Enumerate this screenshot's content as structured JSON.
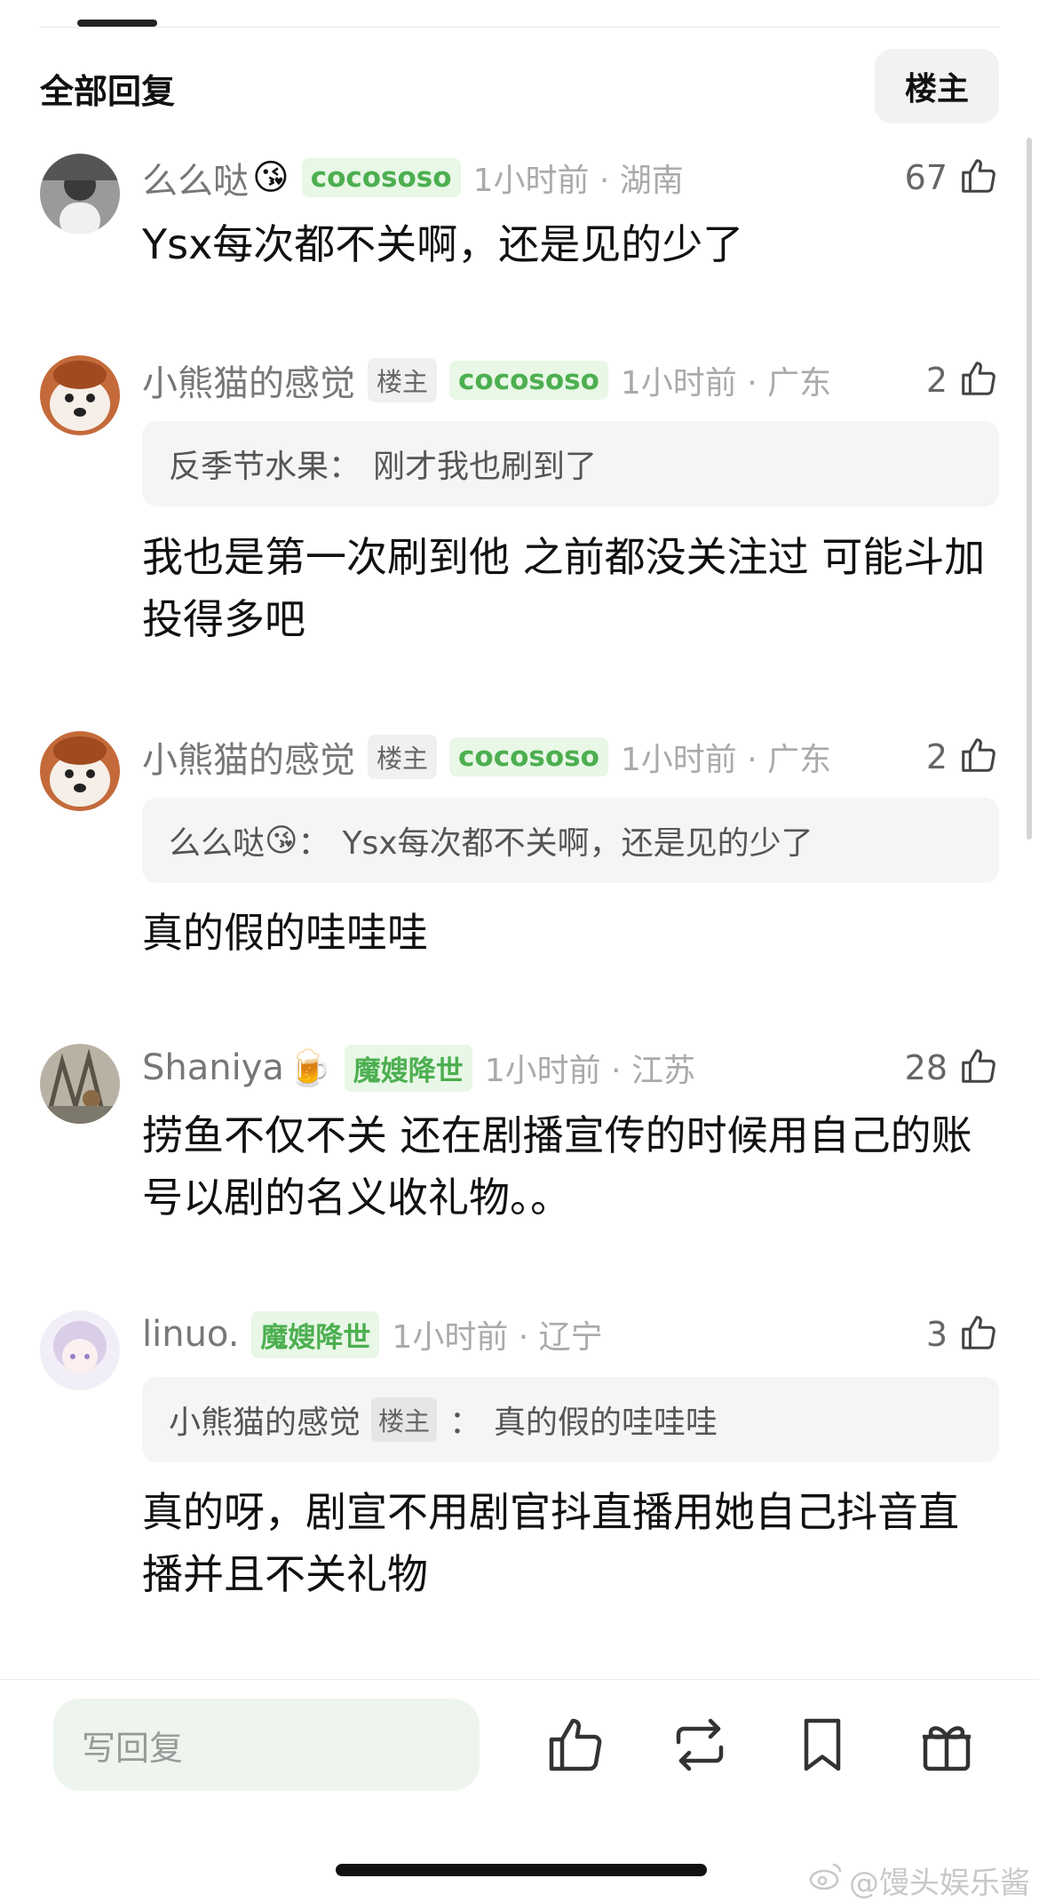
{
  "header": {
    "section_title": "全部回复",
    "op_filter_label": "楼主"
  },
  "comments": [
    {
      "username": "么么哒",
      "emoji": "😘",
      "op_badge": "",
      "fan_badge": "cocososo",
      "meta": "1小时前 · 湖南",
      "likes": "67",
      "quote": null,
      "text": "Ysx每次都不关啊，还是见的少了"
    },
    {
      "username": "小熊猫的感觉",
      "emoji": "",
      "op_badge": "楼主",
      "fan_badge": "cocososo",
      "meta": "1小时前 · 广东",
      "likes": "2",
      "quote": {
        "author": "反季节水果",
        "emoji": "",
        "badge": "",
        "text": "刚才我也刷到了"
      },
      "text": "我也是第一次刷到他 之前都没关注过 可能斗加投得多吧"
    },
    {
      "username": "小熊猫的感觉",
      "emoji": "",
      "op_badge": "楼主",
      "fan_badge": "cocososo",
      "meta": "1小时前 · 广东",
      "likes": "2",
      "quote": {
        "author": "么么哒",
        "emoji": "😘",
        "badge": "",
        "text": "Ysx每次都不关啊，还是见的少了"
      },
      "text": "真的假的哇哇哇"
    },
    {
      "username": "Shaniya",
      "emoji": "🍺",
      "op_badge": "",
      "fan_badge": "魔嫂降世",
      "meta": "1小时前 · 江苏",
      "likes": "28",
      "quote": null,
      "text": "捞鱼不仅不关 还在剧播宣传的时候用自己的账号以剧的名义收礼物。。"
    },
    {
      "username": "linuo.",
      "emoji": "",
      "op_badge": "",
      "fan_badge": "魔嫂降世",
      "meta": "1小时前 · 辽宁",
      "likes": "3",
      "quote": {
        "author": "小熊猫的感觉",
        "emoji": "",
        "badge": "楼主",
        "text": "真的假的哇哇哇"
      },
      "text": "真的呀，剧宣不用剧官抖直播用她自己抖音直播并且不关礼物"
    }
  ],
  "footer": {
    "reply_placeholder": "写回复"
  },
  "watermark": "@馒头娱乐酱",
  "colors": {
    "fan_badge_bg": "#e8f7e6",
    "fan_badge_text": "#4caf50",
    "input_bg": "#eef5ee"
  }
}
